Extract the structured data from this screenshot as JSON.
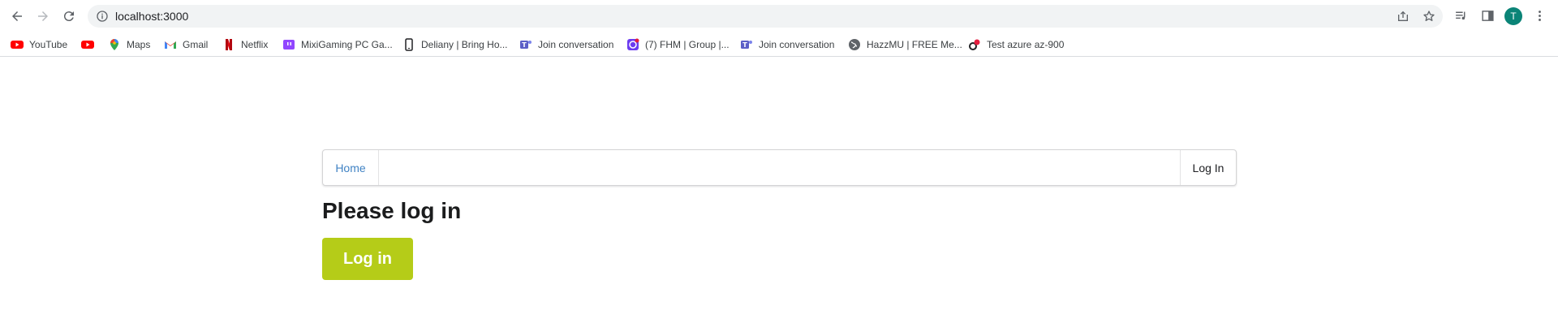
{
  "browser": {
    "url": "localhost:3000",
    "avatar_initial": "T",
    "avatar_color": "#0b8477"
  },
  "bookmarks": [
    {
      "label": "YouTube",
      "icon": "youtube-icon"
    },
    {
      "label": "",
      "icon": "youtube-icon"
    },
    {
      "label": "Maps",
      "icon": "maps-pin-icon"
    },
    {
      "label": "Gmail",
      "icon": "gmail-icon"
    },
    {
      "label": "Netflix",
      "icon": "netflix-icon"
    },
    {
      "label": "MixiGaming PC Ga...",
      "icon": "twitch-icon"
    },
    {
      "label": "Deliany | Bring Ho...",
      "icon": "phone-icon"
    },
    {
      "label": "Join conversation",
      "icon": "teams-icon"
    },
    {
      "label": "(7) FHM | Group |...",
      "icon": "messenger-icon"
    },
    {
      "label": "Join conversation",
      "icon": "teams-icon"
    },
    {
      "label": "HazzMU | FREE Me...",
      "icon": "globe-icon"
    },
    {
      "label": "Test azure az-900",
      "icon": "quizlet-icon"
    }
  ],
  "page": {
    "nav": {
      "home_label": "Home",
      "login_label": "Log In"
    },
    "heading": "Please log in",
    "login_button_label": "Log in",
    "accent_color": "#b5cc18",
    "link_color": "#4183c4"
  }
}
